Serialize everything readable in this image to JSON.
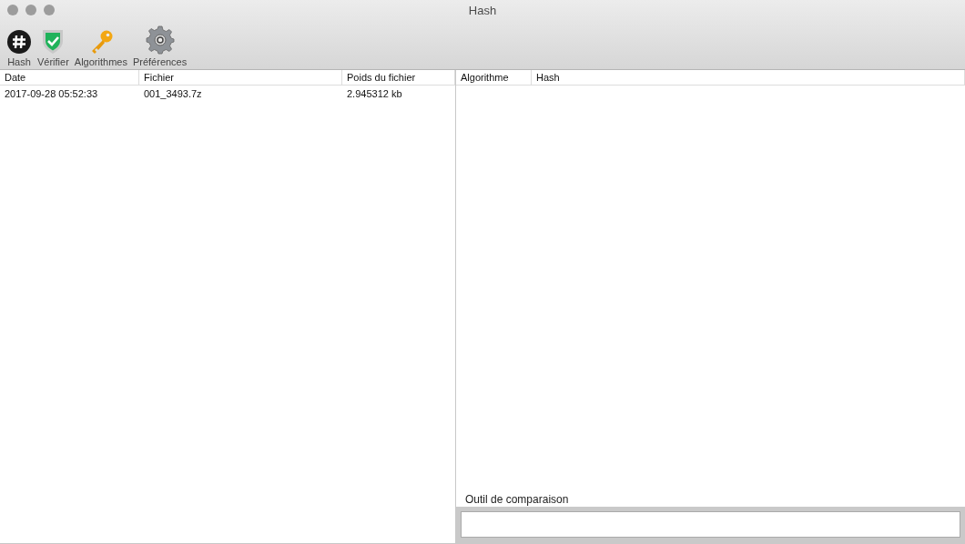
{
  "window": {
    "title": "Hash"
  },
  "toolbar": [
    {
      "kind": "hash",
      "label": "Hash"
    },
    {
      "kind": "verify",
      "label": "Vérifier"
    },
    {
      "kind": "key",
      "label": "Algorithmes"
    },
    {
      "kind": "gear",
      "label": "Préférences"
    }
  ],
  "files_table": {
    "columns": [
      "Date",
      "Fichier",
      "Poids du fichier"
    ],
    "rows": [
      [
        "2017-09-28 05:52:33",
        "001_3493.7z",
        "2.945312 kb"
      ]
    ]
  },
  "hash_table": {
    "columns": [
      "Algorithme",
      "Hash"
    ]
  },
  "compare": {
    "label": "Outil de comparaison"
  }
}
